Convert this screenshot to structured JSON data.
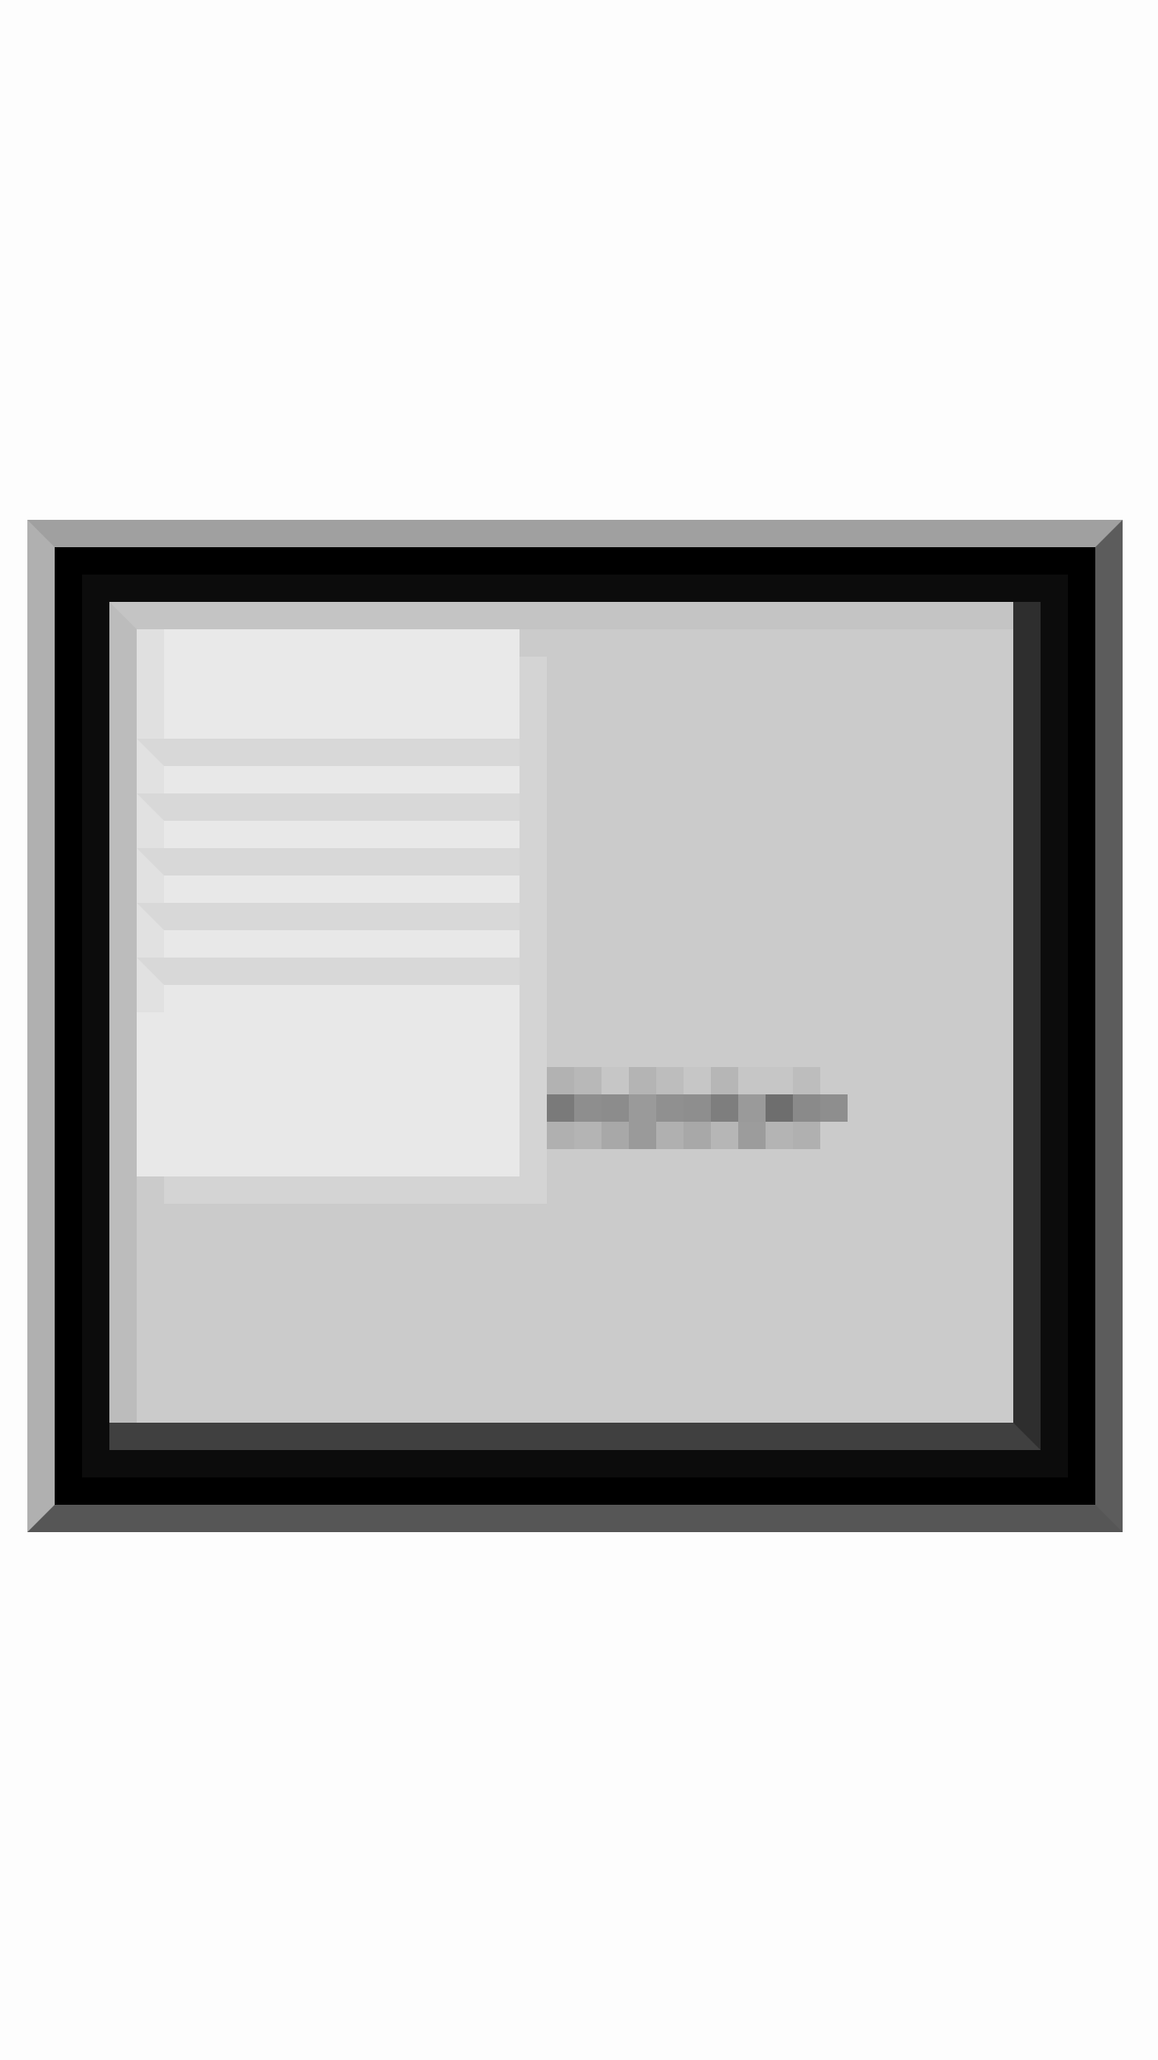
{
  "window": {
    "title": ""
  },
  "menu": {
    "items": [
      {
        "label": ""
      },
      {
        "label": ""
      },
      {
        "label": ""
      },
      {
        "label": ""
      },
      {
        "label": ""
      }
    ]
  },
  "content": {
    "placeholder_text": ""
  },
  "colors": {
    "frame_light": "#a0a0a0",
    "frame_dark": "#565656",
    "frame_black": "#000000",
    "viewport_bg": "#cacaca",
    "menu_bg": "#e8e8e8",
    "menu_separator": "#d8d8d8",
    "text_blur": "#7a7a7a"
  }
}
